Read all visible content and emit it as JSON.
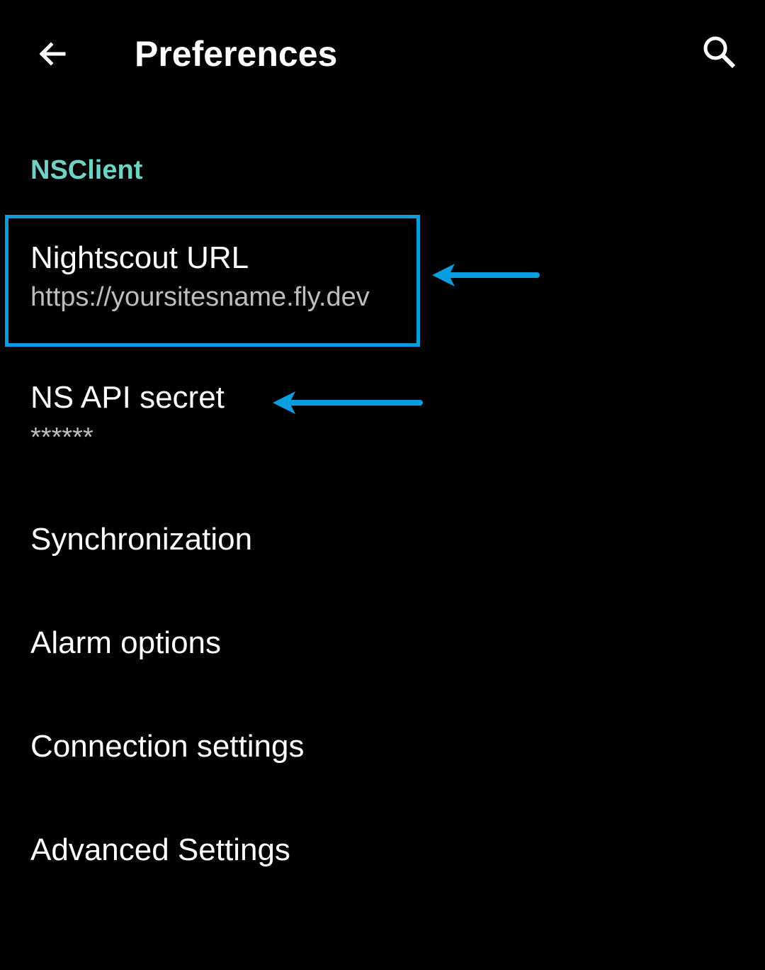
{
  "app_bar": {
    "title": "Preferences",
    "back_icon": "arrow-back-icon",
    "search_icon": "search-icon"
  },
  "category": {
    "label": "NSClient"
  },
  "preferences": [
    {
      "title": "Nightscout URL",
      "summary": "https://yoursitesname.fly.dev"
    },
    {
      "title": "NS API secret",
      "summary": "******"
    },
    {
      "title": "Synchronization"
    },
    {
      "title": "Alarm options"
    },
    {
      "title": "Connection settings"
    },
    {
      "title": "Advanced Settings"
    }
  ],
  "colors": {
    "background": "#000000",
    "category_accent": "#6ed3c4",
    "annotation": "#0a9de0",
    "summary_text": "#bdbdbd"
  }
}
